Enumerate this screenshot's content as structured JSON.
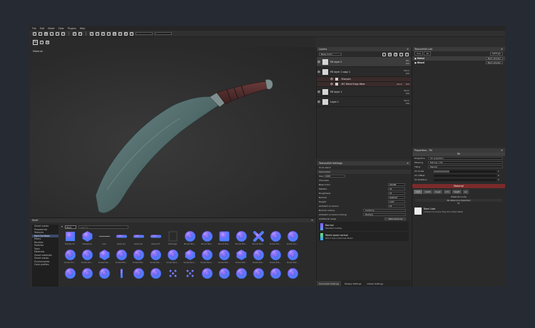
{
  "menu": [
    "File",
    "Edit",
    "Mode",
    "View",
    "Plugins",
    "Help"
  ],
  "viewport": {
    "label": "Material"
  },
  "layers": {
    "title": "Layers",
    "channel_select": "Base Color",
    "rows": [
      {
        "name": "Fill layer 2",
        "blend": "Pbo",
        "opacity": "100",
        "selected": true
      },
      {
        "name": "Fill layer 1 copy 1",
        "blend": "Norm",
        "opacity": "100",
        "selected": false
      },
      {
        "name": "Fill layer 1",
        "blend": "Norm",
        "opacity": "100",
        "selected": false
      },
      {
        "name": "Layer 1",
        "blend": "Norm",
        "opacity": "100",
        "selected": false
      }
    ],
    "sub_rows": [
      {
        "name": "Sharpen",
        "blend": ""
      },
      {
        "name": "MG Metal Edge Wear",
        "blend": "Norm",
        "opacity": "100"
      }
    ]
  },
  "texset_settings": {
    "title": "TextureSet Settings",
    "row1": "Undo stack",
    "row2": "TextureSet",
    "size_label": "Size",
    "size_value": "2048",
    "channels_label": "Channels",
    "channels": [
      {
        "name": "Base Color",
        "value": "sRGB8"
      },
      {
        "name": "Metallic",
        "value": "L8"
      },
      {
        "name": "Roughness",
        "value": "L8"
      },
      {
        "name": "Normal",
        "value": "RGB16F"
      },
      {
        "name": "Height",
        "value": "L16F"
      },
      {
        "name": "Ambient occlusion",
        "value": "L8"
      }
    ],
    "normal_mixing_label": "Normal mixing",
    "normal_mixing_value": "Combine",
    "ao_mixing_label": "Ambient occlusion mixing",
    "ao_mixing_value": "Multiply",
    "additional_maps_label": "Additional maps",
    "bake_button": "Bake textures",
    "maps": [
      {
        "title": "Normal",
        "sub": "MeshNormalMap"
      },
      {
        "title": "World space normal",
        "sub": "World Space Normals Metal"
      }
    ]
  },
  "bottom_tabs": [
    "TextureSet Settings",
    "Display Settings",
    "Viewer Settings"
  ],
  "texset_list": {
    "title": "TextureSet List",
    "solo_label": "Solo",
    "all_label": "All",
    "settings_label": "Settings",
    "rows": [
      {
        "name": "Metal",
        "shader": "Main shader",
        "selected": true
      },
      {
        "name": "Wood",
        "shader": "Main shader",
        "selected": false
      }
    ]
  },
  "properties": {
    "title": "Properties - Fill",
    "fill_header": "Fill",
    "rows": [
      {
        "label": "Projection",
        "value": "UV projection"
      },
      {
        "label": "Filtering",
        "value": "Bilinear | HQ"
      },
      {
        "label": "Tiling",
        "value": "Repeat"
      }
    ],
    "sliders": [
      {
        "label": "UV Scale",
        "value": "1",
        "fill": 0.25
      },
      {
        "label": "UV Offset",
        "value": "0",
        "fill": 0
      },
      {
        "label": "UV Rotation",
        "value": "0",
        "fill": 0
      }
    ],
    "material_header": "Material",
    "chips": [
      "color",
      "metal",
      "rough",
      "nrm",
      "height",
      "ao"
    ],
    "material_mode": "Material mode",
    "material_mode_value": "No Resource Selected",
    "or_label": "Or",
    "base_color_title": "Base Color",
    "base_color_sub": "Ambient Occlusion Map from Mesh Metal"
  },
  "shelf": {
    "title": "Shelf",
    "categories": [
      "Smart masks",
      "Procedurals",
      "Textures",
      "Hard Surfaces",
      "Filters",
      "Brushes",
      "Particles",
      "Tools",
      "Materials",
      "Smart materials",
      "Smart masks",
      "Environments",
      "Color profiles"
    ],
    "selected_category": 3,
    "search_box": "Hard",
    "search_placeholder": "Search...",
    "items": [
      {
        "label": "Handle_01",
        "shape": "cross"
      },
      {
        "label": "Hexagone",
        "shape": "hex"
      },
      {
        "label": "Line",
        "shape": "line"
      },
      {
        "label": "panel_01",
        "shape": "pill"
      },
      {
        "label": "panel_02",
        "shape": "pill"
      },
      {
        "label": "panel_03",
        "shape": "pill"
      },
      {
        "label": "Rectangle",
        "shape": "rect"
      },
      {
        "label": "Round Sha...",
        "shape": "circle"
      },
      {
        "label": "Round Sha...",
        "shape": "circle"
      },
      {
        "label": "Round Sha...",
        "shape": "square"
      },
      {
        "label": "Round Sha...",
        "shape": "circle"
      },
      {
        "label": "Round Sha...",
        "shape": "x"
      },
      {
        "label": "Screw Circ...",
        "shape": "circle"
      },
      {
        "label": "Screw Circ...",
        "shape": "circle"
      },
      {
        "label": "Screw Circ...",
        "shape": "circle"
      },
      {
        "label": "Screw Circ...",
        "shape": "circle"
      },
      {
        "label": "Screw Hex...",
        "shape": "hex"
      },
      {
        "label": "Screw Phill...",
        "shape": "circle"
      },
      {
        "label": "Screw Phill...",
        "shape": "circle"
      },
      {
        "label": "Screw Poz...",
        "shape": "circle"
      },
      {
        "label": "Screw Secu...",
        "shape": "circle"
      },
      {
        "label": "Screw Secu...",
        "shape": "hex"
      },
      {
        "label": "Screw Secu...",
        "shape": "circle"
      },
      {
        "label": "Screw Slot...",
        "shape": "circle"
      },
      {
        "label": "Screw Slot...",
        "shape": "hex"
      },
      {
        "label": "Screw Slot...",
        "shape": "circle"
      },
      {
        "label": "Screw Slot...",
        "shape": "circle"
      },
      {
        "label": "Screw Slot...",
        "shape": "circle"
      },
      {
        "label": "",
        "shape": "circle"
      },
      {
        "label": "",
        "shape": "circle"
      },
      {
        "label": "",
        "shape": "circle"
      },
      {
        "label": "",
        "shape": "bar"
      },
      {
        "label": "",
        "shape": "circle"
      },
      {
        "label": "",
        "shape": "circle"
      },
      {
        "label": "",
        "shape": "dots"
      },
      {
        "label": "",
        "shape": "dots"
      },
      {
        "label": "",
        "shape": "circle"
      },
      {
        "label": "",
        "shape": "circle"
      },
      {
        "label": "",
        "shape": "circle"
      },
      {
        "label": "",
        "shape": "circle"
      },
      {
        "label": "",
        "shape": "circle"
      },
      {
        "label": "",
        "shape": "circle"
      }
    ]
  },
  "colors": {
    "accent_red": "#7a2b2b",
    "shelf_purple": "#8c6cff",
    "shelf_blue": "#5aa8ff"
  }
}
